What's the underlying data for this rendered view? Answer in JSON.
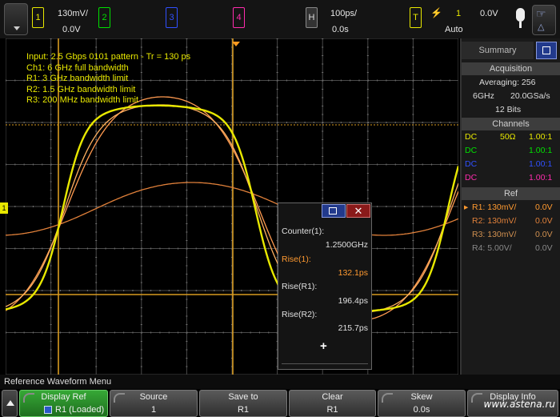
{
  "colors": {
    "ch1": "#e8e800",
    "ch2": "#00e000",
    "ch3": "#3050ff",
    "ch4": "#ff2cae",
    "ref1": "#ff9a30",
    "ref2": "#e0803a",
    "ref3": "#d09050",
    "ref4": "#888888"
  },
  "topbar": {
    "ch1": {
      "num": "1",
      "scale": "130mV/",
      "offset": "0.0V"
    },
    "ch2": {
      "num": "2"
    },
    "ch3": {
      "num": "3"
    },
    "ch4": {
      "num": "4"
    },
    "horizontal": {
      "key": "H",
      "scale": "100ps/",
      "delay": "0.0s"
    },
    "trigger": {
      "key": "T",
      "source": "1",
      "level": "0.0V",
      "mode": "Auto"
    }
  },
  "annotations": [
    "Input: 2.5 Gbps 0101 pattern - Tr = 130 ps",
    "Ch1: 6 GHz full bandwidth",
    "R1: 3 GHz bandwidth limit",
    "R2: 1.5 GHz bandwidth limit",
    "R3: 200 MHz bandwidth limit"
  ],
  "side": {
    "tab": "Summary",
    "acq_head": "Acquisition",
    "averaging": "Averaging: 256",
    "bw": "6GHz",
    "srate": "20.0GSa/s",
    "bits": "12 Bits",
    "ch_head": "Channels",
    "channels": [
      {
        "cpl": "DC",
        "imp": "50Ω",
        "ratio": "1.00:1"
      },
      {
        "cpl": "DC",
        "imp": "",
        "ratio": "1.00:1"
      },
      {
        "cpl": "DC",
        "imp": "",
        "ratio": "1.00:1"
      },
      {
        "cpl": "DC",
        "imp": "",
        "ratio": "1.00:1"
      }
    ],
    "ref_head": "Ref",
    "refs": [
      {
        "marker": "▸",
        "label": "R1: 130mV/",
        "offset": "0.0V"
      },
      {
        "marker": "",
        "label": "R2: 130mV/",
        "offset": "0.0V"
      },
      {
        "marker": "",
        "label": "R3: 130mV/",
        "offset": "0.0V"
      },
      {
        "marker": "",
        "label": "R4: 5.00V/",
        "offset": "0.0V"
      }
    ]
  },
  "meas": {
    "counter_label": "Counter(1):",
    "counter_value": "1.2500GHz",
    "rise1_label": "Rise(1):",
    "rise1_value": "132.1ps",
    "riseR1_label": "Rise(R1):",
    "riseR1_value": "196.4ps",
    "riseR2_label": "Rise(R2):",
    "riseR2_value": "215.7ps",
    "add": "+"
  },
  "menu_title": "Reference Waveform Menu",
  "softkeys": [
    {
      "title": "Display Ref",
      "value": "R1 (Loaded)"
    },
    {
      "title": "Source",
      "value": "1"
    },
    {
      "title": "Save to",
      "value": "R1"
    },
    {
      "title": "Clear",
      "value": "R1"
    },
    {
      "title": "Skew",
      "value": "0.0s"
    },
    {
      "title": "Display Info",
      "value": ""
    }
  ],
  "watermark": "www.astena.ru"
}
